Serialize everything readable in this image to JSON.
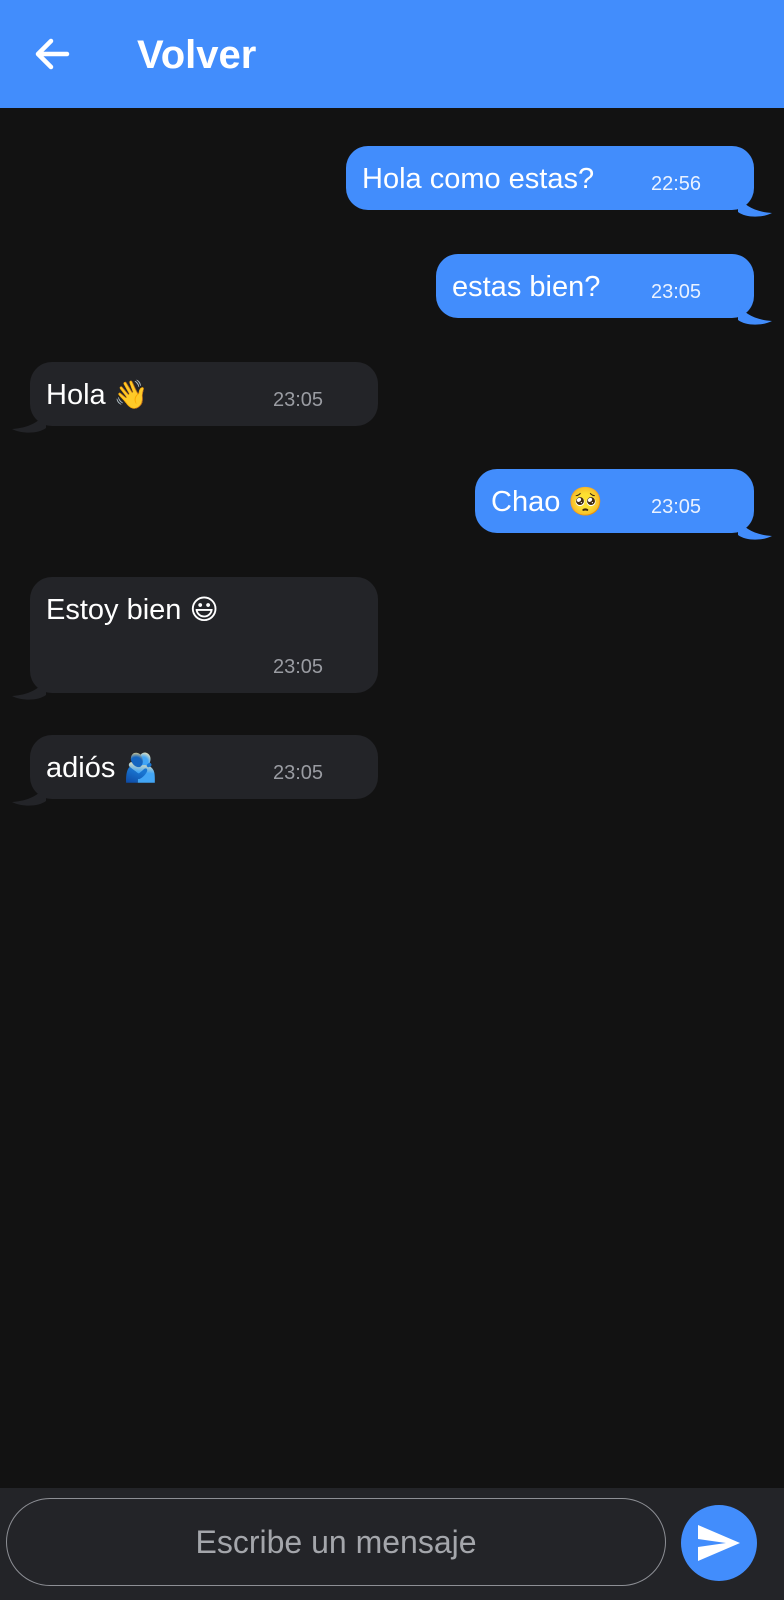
{
  "appbar": {
    "back_icon": "arrow-left-icon",
    "title": "Volver"
  },
  "colors": {
    "accent": "#428dfc",
    "background": "#121212",
    "incoming_bubble": "#232428",
    "composer_background": "#232428"
  },
  "messages": [
    {
      "direction": "outgoing",
      "text": "Hola como estas?",
      "time": "22:56"
    },
    {
      "direction": "outgoing",
      "text": "estas bien?",
      "time": "23:05"
    },
    {
      "direction": "incoming",
      "text": "Hola",
      "emoji": "👋",
      "time": "23:05"
    },
    {
      "direction": "outgoing",
      "text": "Chao",
      "emoji": "🥺",
      "time": "23:05"
    },
    {
      "direction": "incoming",
      "text": "Estoy bien",
      "emoji": "😃",
      "time": "23:05"
    },
    {
      "direction": "incoming",
      "text": "adiós",
      "emoji": "🫂",
      "time": "23:05"
    }
  ],
  "composer": {
    "placeholder": "Escribe un mensaje",
    "send_icon": "send-icon"
  }
}
